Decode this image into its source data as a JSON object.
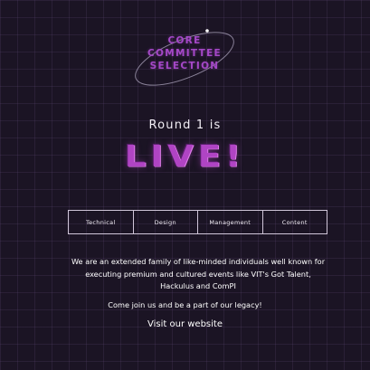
{
  "logo": {
    "line1": "CORE",
    "line2": "COMMITTEE",
    "line3": "SELECTION"
  },
  "headline": {
    "round": "Round 1 is",
    "live": "LIVE!"
  },
  "tabs": [
    {
      "label": "Technical"
    },
    {
      "label": "Design"
    },
    {
      "label": "Management"
    },
    {
      "label": "Content"
    }
  ],
  "description": {
    "line1": "We are an extended family of like-minded individuals well known for",
    "line2": "executing premium and cultured events like VIT's Got Talent,",
    "line3": "Hackulus and ComPI"
  },
  "join_text": "Come join us and be a part of our legacy!",
  "visit_link": "Visit our website",
  "colors": {
    "background": "#1b1424",
    "accent": "#a548c8",
    "live": "#b044c4"
  }
}
